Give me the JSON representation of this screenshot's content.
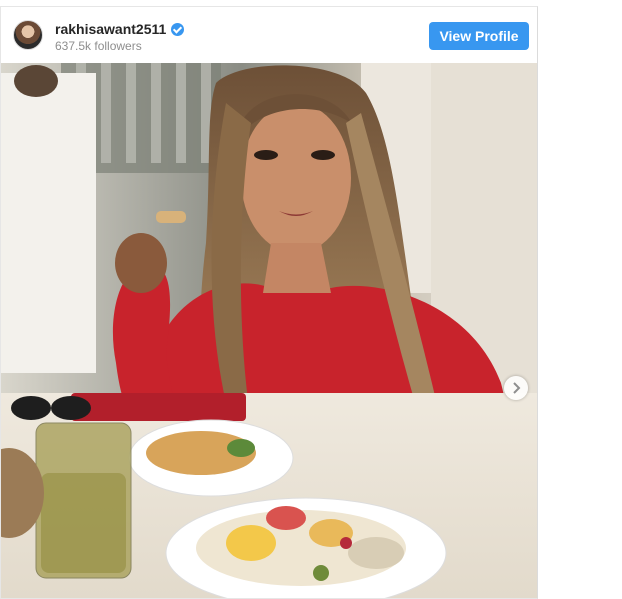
{
  "post": {
    "username": "rakhisawant2511",
    "followers": "637.5k followers",
    "view_profile_label": "View Profile",
    "verified": true
  },
  "icons": {
    "verified": "verified-badge-icon",
    "next": "chevron-right-icon"
  },
  "colors": {
    "accent": "#3897f0",
    "username": "#262626",
    "secondary_text": "#8e8e8e"
  }
}
